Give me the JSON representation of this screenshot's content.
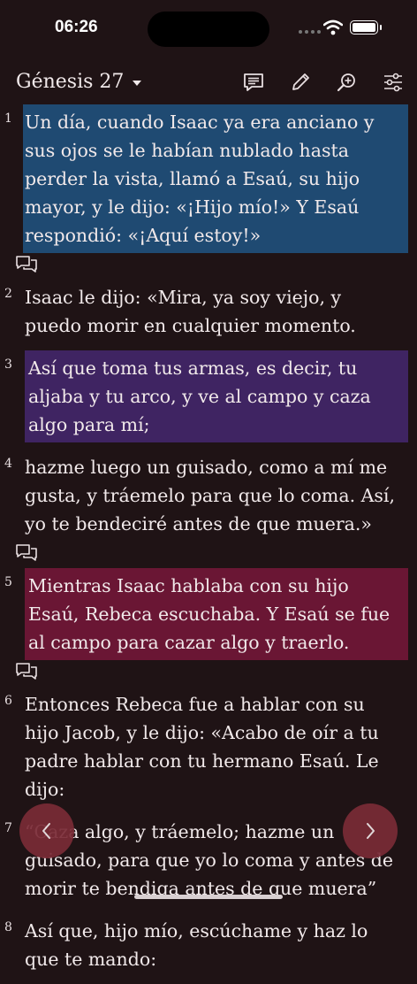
{
  "status": {
    "time": "06:26"
  },
  "header": {
    "title": "Génesis 27"
  },
  "toolbar_icons": [
    "notes-icon",
    "pencil-icon",
    "zoom-search-icon",
    "settings-sliders-icon"
  ],
  "verses": [
    {
      "num": "1",
      "text": "Un día, cuando Isaac ya era anciano y sus ojos se le habían nublado hasta perder la vista, llamó a Esaú, su hijo mayor, y le dijo: «¡Hijo mío!» Y Esaú respondió: «¡Aquí estoy!»",
      "highlight": "blue",
      "note": true
    },
    {
      "num": "2",
      "text": "Isaac le dijo: «Mira, ya soy viejo, y puedo morir en cualquier momento.",
      "highlight": "none",
      "note": false
    },
    {
      "num": "3",
      "text": "Así que toma tus armas, es decir, tu aljaba y tu arco, y ve al campo y caza algo para mí;",
      "highlight": "purple",
      "note": false
    },
    {
      "num": "4",
      "text": "hazme luego un guisado, como a mí me gusta, y tráemelo para que lo coma. Así, yo te bendeciré antes de que muera.»",
      "highlight": "none",
      "note": true
    },
    {
      "num": "5",
      "text": "Mientras Isaac hablaba con su hijo Esaú, Rebeca escuchaba. Y Esaú se fue al campo para cazar algo y traerlo.",
      "highlight": "red",
      "note": true
    },
    {
      "num": "6",
      "text": "Entonces Rebeca fue a hablar con su hijo Jacob, y le dijo: «Acabo de oír a tu padre hablar con tu hermano Esaú. Le dijo:",
      "highlight": "none",
      "note": false
    },
    {
      "num": "7",
      "text": "“Caza algo, y tráemelo; hazme un guisado, para que yo lo coma y antes de morir te bendiga antes de que muera”",
      "highlight": "none",
      "note": false
    },
    {
      "num": "8",
      "text": "Así que, hijo mío, escúchame y haz lo que te mando:",
      "highlight": "none",
      "note": false
    }
  ],
  "colors": {
    "background": "#1f1315",
    "highlight_blue": "#1f4a72",
    "highlight_purple": "#3f2462",
    "highlight_red": "#6a1634",
    "nav_button": "#7a2b36"
  }
}
